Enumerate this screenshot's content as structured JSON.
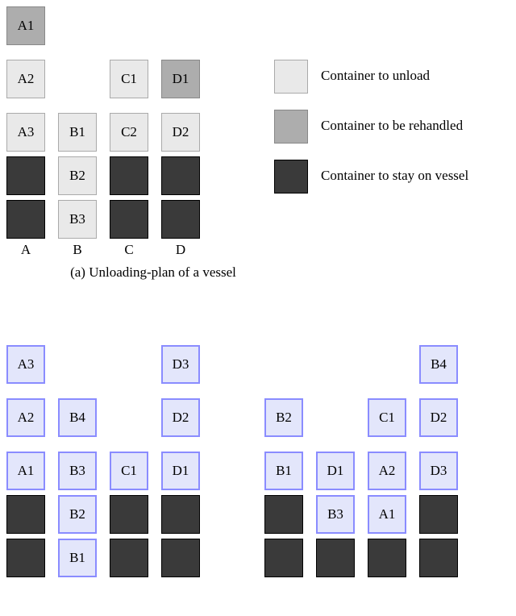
{
  "legend": {
    "unload": "Container to unload",
    "rehandle": "Container to be rehandled",
    "stay": "Container to stay on vessel"
  },
  "caption_a": "(a) Unloading-plan of a vessel",
  "vessel": {
    "col_labels": [
      "A",
      "B",
      "C",
      "D"
    ],
    "cells": {
      "a1": "A1",
      "a2": "A2",
      "a3": "A3",
      "b1": "B1",
      "b2": "B2",
      "b3": "B3",
      "c1": "C1",
      "c2": "C2",
      "d1": "D1",
      "d2": "D2"
    }
  },
  "yard_left": {
    "a3": "A3",
    "a2": "A2",
    "a1": "A1",
    "b4": "B4",
    "b3": "B3",
    "b2": "B2",
    "b1": "B1",
    "c1": "C1",
    "d3": "D3",
    "d2": "D2",
    "d1": "D1"
  },
  "yard_right": {
    "b2": "B2",
    "b1": "B1",
    "d1": "D1",
    "b3": "B3",
    "c1": "C1",
    "a2": "A2",
    "a1": "A1",
    "b4": "B4",
    "d2": "D2",
    "d3": "D3"
  },
  "chart_data": {
    "type": "table",
    "title": "Container diagram",
    "vessel_grid": {
      "columns": [
        "A",
        "B",
        "C",
        "D"
      ],
      "rows_top_to_bottom": [
        [
          {
            "label": "A1",
            "type": "rehandle"
          },
          null,
          null,
          null
        ],
        [
          {
            "label": "A2",
            "type": "unload"
          },
          null,
          {
            "label": "C1",
            "type": "unload"
          },
          {
            "label": "D1",
            "type": "rehandle"
          }
        ],
        [
          {
            "label": "A3",
            "type": "unload"
          },
          {
            "label": "B1",
            "type": "unload"
          },
          {
            "label": "C2",
            "type": "unload"
          },
          {
            "label": "D2",
            "type": "unload"
          }
        ],
        [
          {
            "label": "",
            "type": "stay"
          },
          {
            "label": "B2",
            "type": "unload"
          },
          {
            "label": "",
            "type": "stay"
          },
          {
            "label": "",
            "type": "stay"
          }
        ],
        [
          {
            "label": "",
            "type": "stay"
          },
          {
            "label": "B3",
            "type": "unload"
          },
          {
            "label": "",
            "type": "stay"
          },
          {
            "label": "",
            "type": "stay"
          }
        ]
      ]
    },
    "yard_left_grid": {
      "columns": 4,
      "rows_top_to_bottom": [
        [
          {
            "label": "A3",
            "type": "yard"
          },
          null,
          null,
          {
            "label": "D3",
            "type": "yard"
          }
        ],
        [
          {
            "label": "A2",
            "type": "yard"
          },
          {
            "label": "B4",
            "type": "yard"
          },
          null,
          {
            "label": "D2",
            "type": "yard"
          }
        ],
        [
          {
            "label": "A1",
            "type": "yard"
          },
          {
            "label": "B3",
            "type": "yard"
          },
          {
            "label": "C1",
            "type": "yard"
          },
          {
            "label": "D1",
            "type": "yard"
          }
        ],
        [
          {
            "label": "",
            "type": "stay"
          },
          {
            "label": "B2",
            "type": "yard"
          },
          {
            "label": "",
            "type": "stay"
          },
          {
            "label": "",
            "type": "stay"
          }
        ],
        [
          {
            "label": "",
            "type": "stay"
          },
          {
            "label": "B1",
            "type": "yard"
          },
          {
            "label": "",
            "type": "stay"
          },
          {
            "label": "",
            "type": "stay"
          }
        ]
      ]
    },
    "yard_right_grid": {
      "columns": 4,
      "rows_top_to_bottom": [
        [
          null,
          null,
          null,
          {
            "label": "B4",
            "type": "yard"
          }
        ],
        [
          {
            "label": "B2",
            "type": "yard"
          },
          null,
          {
            "label": "C1",
            "type": "yard"
          },
          {
            "label": "D2",
            "type": "yard"
          }
        ],
        [
          {
            "label": "B1",
            "type": "yard"
          },
          {
            "label": "D1",
            "type": "yard"
          },
          {
            "label": "A2",
            "type": "yard"
          },
          {
            "label": "D3",
            "type": "yard"
          }
        ],
        [
          {
            "label": "",
            "type": "stay"
          },
          {
            "label": "B3",
            "type": "yard"
          },
          {
            "label": "A1",
            "type": "yard"
          },
          {
            "label": "",
            "type": "stay"
          }
        ],
        [
          {
            "label": "",
            "type": "stay"
          },
          {
            "label": "",
            "type": "stay"
          },
          {
            "label": "",
            "type": "stay"
          },
          {
            "label": "",
            "type": "stay"
          }
        ]
      ]
    }
  }
}
